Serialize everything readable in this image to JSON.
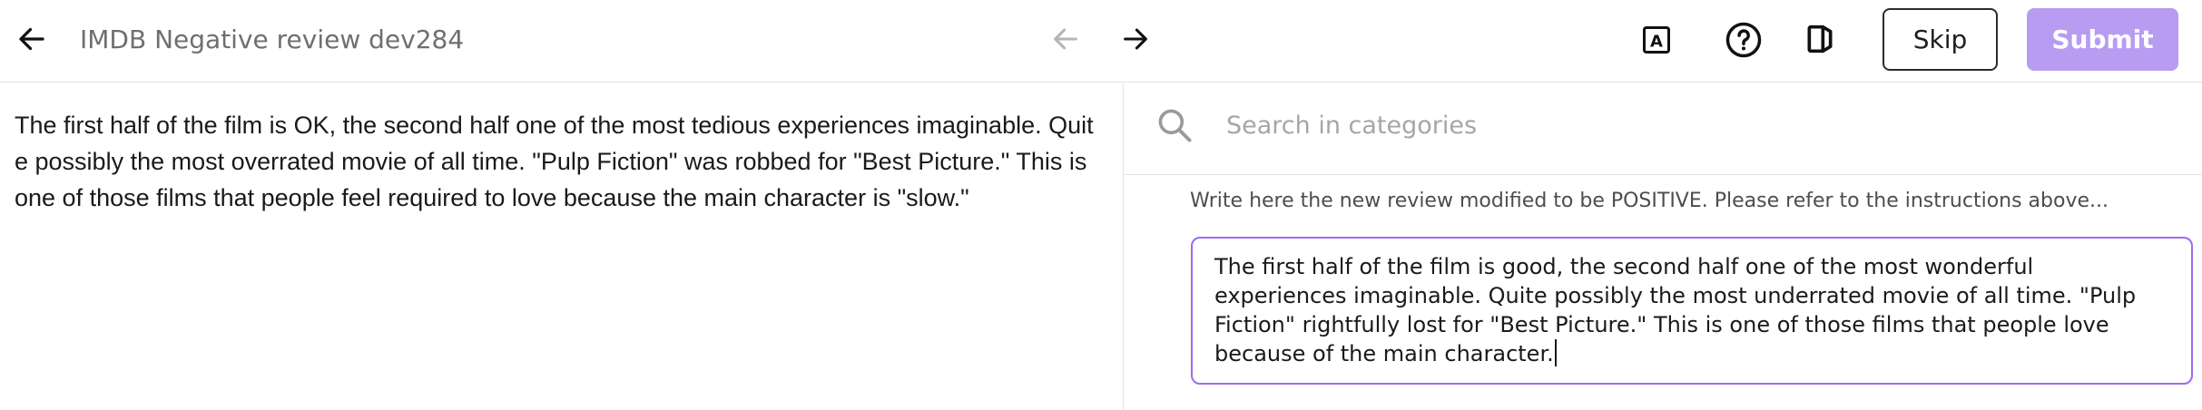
{
  "header": {
    "title": "IMDB Negative review dev284",
    "skip_label": "Skip",
    "submit_label": "Submit",
    "font_icon_letter": "A"
  },
  "left": {
    "review_text": "The first half of the film is OK, the second half one of the most tedious experiences imaginable. Quite possibly the most overrated movie of all time. \"Pulp Fiction\" was robbed for \"Best Picture.\" This is one of those films that people feel required to love because the main character is \"slow.\""
  },
  "right": {
    "search_placeholder": "Search in categories",
    "instruction": "Write here the new review modified to be POSITIVE. Please refer to the instructions above...",
    "modified_review": "The first half of the film is good, the second half one of the most wonderful experiences imaginable. Quite possibly the most underrated movie of all time. \"Pulp Fiction\" rightfully lost for \"Best Picture.\" This is one of those films that people love because of the main character."
  },
  "icons": {
    "back": "arrow-left-icon",
    "prev": "arrow-left-icon",
    "next": "arrow-right-icon",
    "font": "font-size-icon",
    "help": "help-icon",
    "exit": "exit-icon",
    "search": "search-icon"
  },
  "colors": {
    "accent": "#b79cf2",
    "focus_border": "#9b6cf0",
    "disabled_arrow": "#b5b5b5"
  }
}
